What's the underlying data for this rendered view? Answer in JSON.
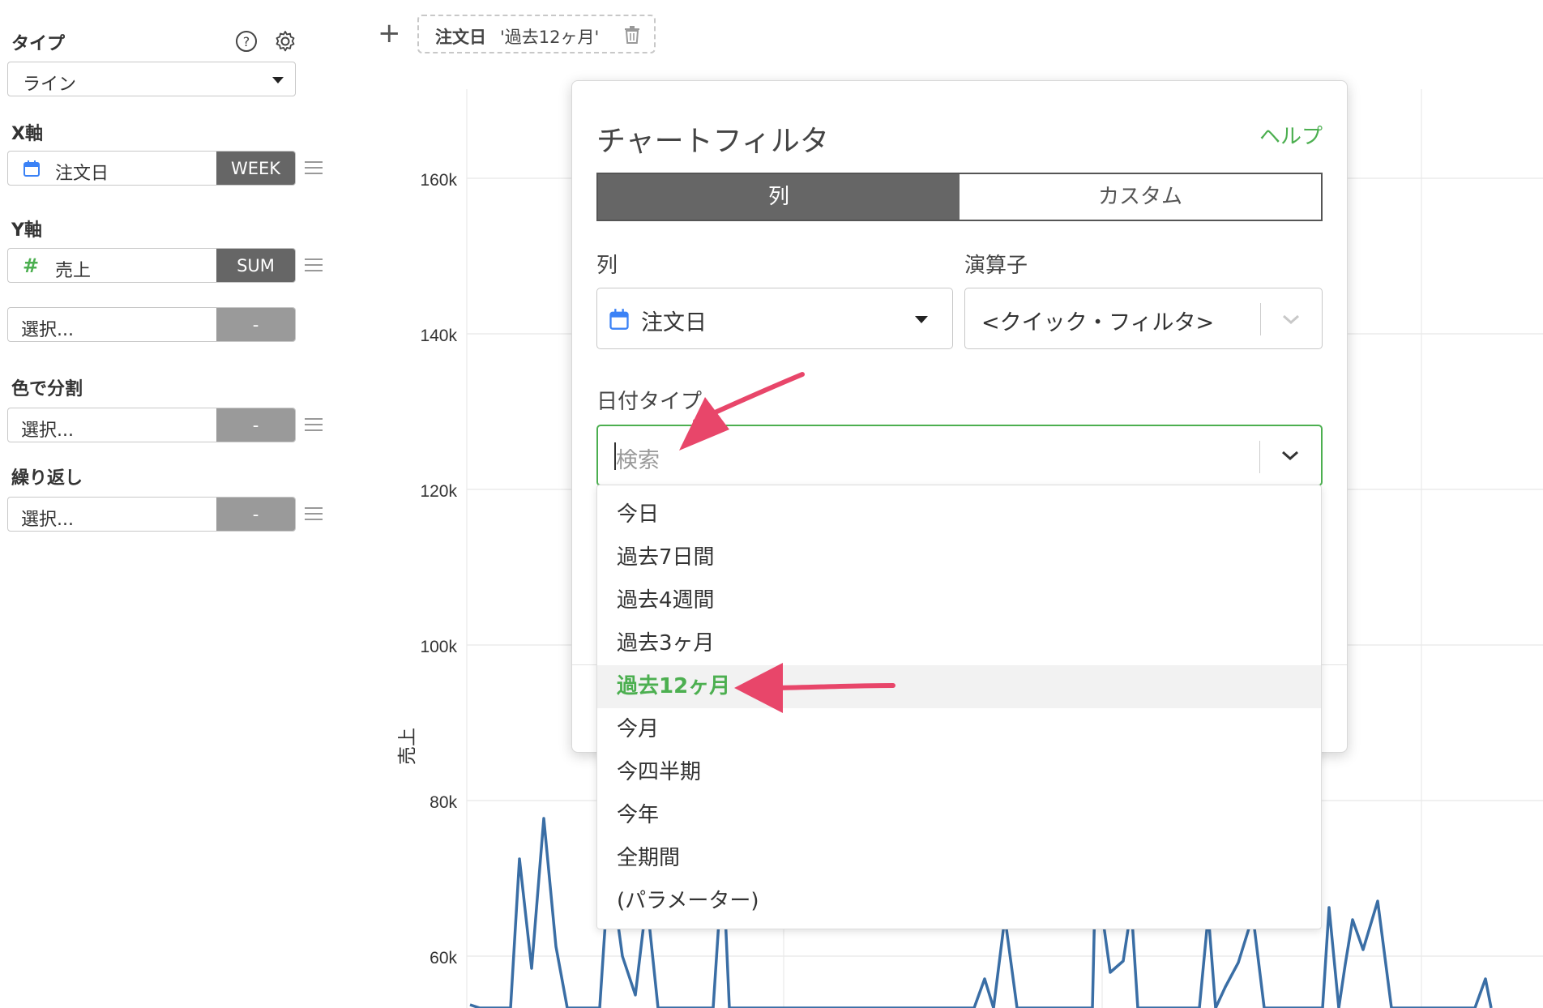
{
  "sidebar": {
    "type_label": "タイプ",
    "type_value": "ライン",
    "x_axis_label": "X軸",
    "x_field": {
      "name": "注文日",
      "agg": "WEEK"
    },
    "y_axis_label": "Y軸",
    "y_field": {
      "name": "売上",
      "agg": "SUM"
    },
    "y_extra": {
      "name": "選択...",
      "agg": "-"
    },
    "color_label": "色で分割",
    "color_field": {
      "name": "選択...",
      "agg": "-"
    },
    "repeat_label": "繰り返し",
    "repeat_field": {
      "name": "選択...",
      "agg": "-"
    },
    "icons": [
      "help-circle-icon",
      "gear-icon",
      "calendar-icon",
      "hash-icon",
      "hamburger-icon"
    ]
  },
  "filter_bar": {
    "add_label": "+",
    "chip_name": "注文日",
    "chip_value": "'過去12ヶ月'"
  },
  "chart": {
    "y_axis_label": "売上",
    "y_ticks": [
      "160k",
      "140k",
      "120k",
      "100k",
      "80k",
      "60k"
    ],
    "line_color": "#3a6ea5"
  },
  "popup": {
    "title": "チャートフィルタ",
    "help": "ヘルプ",
    "tabs": [
      "列",
      "カスタム"
    ],
    "column_label": "列",
    "column_value": "注文日",
    "operator_label": "演算子",
    "operator_value": "<クイック・フィルタ>",
    "date_type_label": "日付タイプ",
    "search_placeholder": "検索"
  },
  "dropdown": {
    "options": [
      "今日",
      "過去7日間",
      "過去4週間",
      "過去3ヶ月",
      "過去12ヶ月",
      "今月",
      "今四半期",
      "今年",
      "全期間",
      "(パラメーター)"
    ],
    "active_index": 4
  },
  "colors": {
    "accent": "#4caf50",
    "arrow": "#e8466a",
    "segment_on": "#666666"
  }
}
